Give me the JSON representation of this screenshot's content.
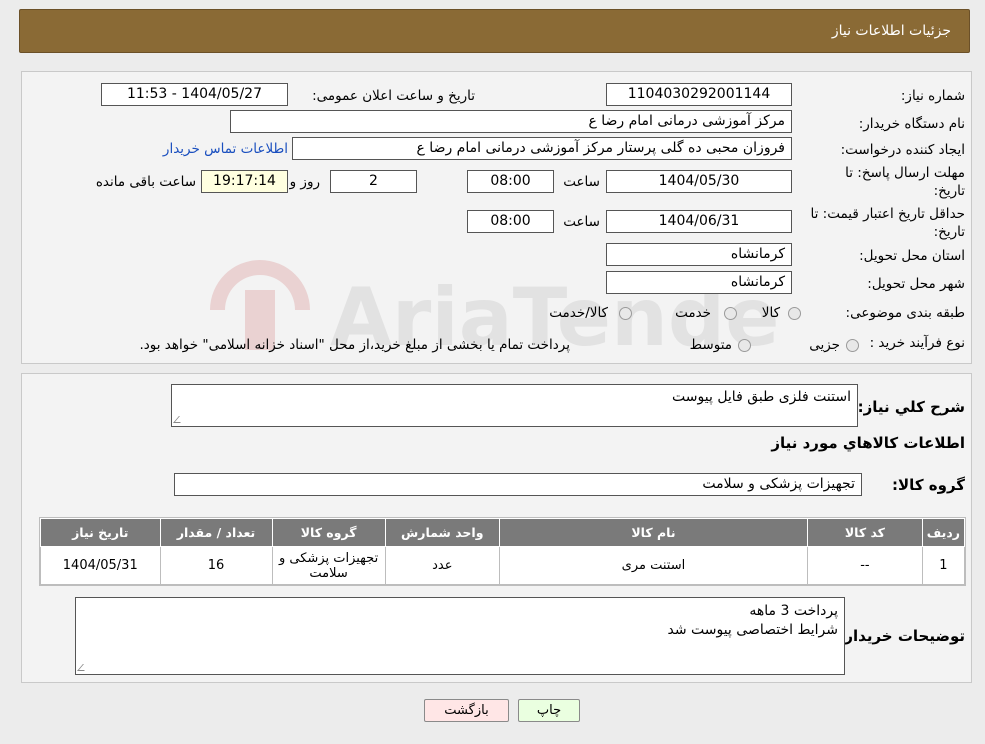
{
  "header": {
    "title": "جزئیات اطلاعات نیاز"
  },
  "form": {
    "need_number_label": "شماره نیاز:",
    "need_number": "1104030292001144",
    "announce_label": "تاریخ و ساعت اعلان عمومی:",
    "announce_value": "1404/05/27 - 11:53",
    "buyer_org_label": "نام دستگاه خریدار:",
    "buyer_org": "مرکز آموزشی  درمانی امام رضا  ع",
    "requester_label": "ایجاد کننده درخواست:",
    "requester": "فروزان محبی ده گلی پرستار مرکز آموزشی  درمانی امام رضا  ع",
    "contact_link": "اطلاعات تماس خریدار",
    "reply_deadline_label_1": "مهلت ارسال پاسخ: تا",
    "reply_deadline_label_2": "تاریخ:",
    "reply_date": "1404/05/30",
    "time_label": "ساعت",
    "reply_time": "08:00",
    "days_value": "2",
    "days_label": "روز و",
    "remaining_time": "19:17:14",
    "remaining_label": "ساعت باقی مانده",
    "price_validity_label_1": "حداقل تاریخ اعتبار قیمت: تا",
    "price_validity_label_2": "تاریخ:",
    "price_date": "1404/06/31",
    "price_time_label": "ساعت",
    "price_time": "08:00",
    "province_label": "استان محل تحویل:",
    "province": "کرمانشاه",
    "city_label": "شهر محل تحویل:",
    "city": "کرمانشاه",
    "category_label": "طبقه بندی موضوعی:",
    "category_options": [
      "کالا",
      "خدمت",
      "کالا/خدمت"
    ],
    "purchase_type_label": "نوع فرآیند خرید :",
    "purchase_options": [
      "جزیی",
      "متوسط"
    ],
    "purchase_note": "پرداخت تمام یا بخشی از مبلغ خرید،از محل \"اسناد خزانه اسلامی\" خواهد بود."
  },
  "details": {
    "description_label": "شرح کلي نياز:",
    "description": "استنت فلزی طبق فایل پیوست",
    "goods_info_title": "اطلاعات کالاهاي مورد نياز",
    "goods_group_label": "گروه کالا:",
    "goods_group": "تجهیزات پزشکی و سلامت",
    "table": {
      "headers": [
        "ردیف",
        "کد کالا",
        "نام کالا",
        "واحد شمارش",
        "گروه کالا",
        "تعداد / مقدار",
        "تاریخ نیاز"
      ],
      "rows": [
        [
          "1",
          "--",
          "استنت مری",
          "عدد",
          "تجهیزات پزشکی و سلامت",
          "16",
          "1404/05/31"
        ]
      ]
    },
    "buyer_notes_label": "توضیحات خریدار:",
    "buyer_notes_line1": "پرداخت 3 ماهه",
    "buyer_notes_line2": "شرایط اختصاصی پیوست شد"
  },
  "buttons": {
    "print": "چاپ",
    "back": "بازگشت"
  },
  "watermark": {
    "text": "AriaTender.neT"
  }
}
